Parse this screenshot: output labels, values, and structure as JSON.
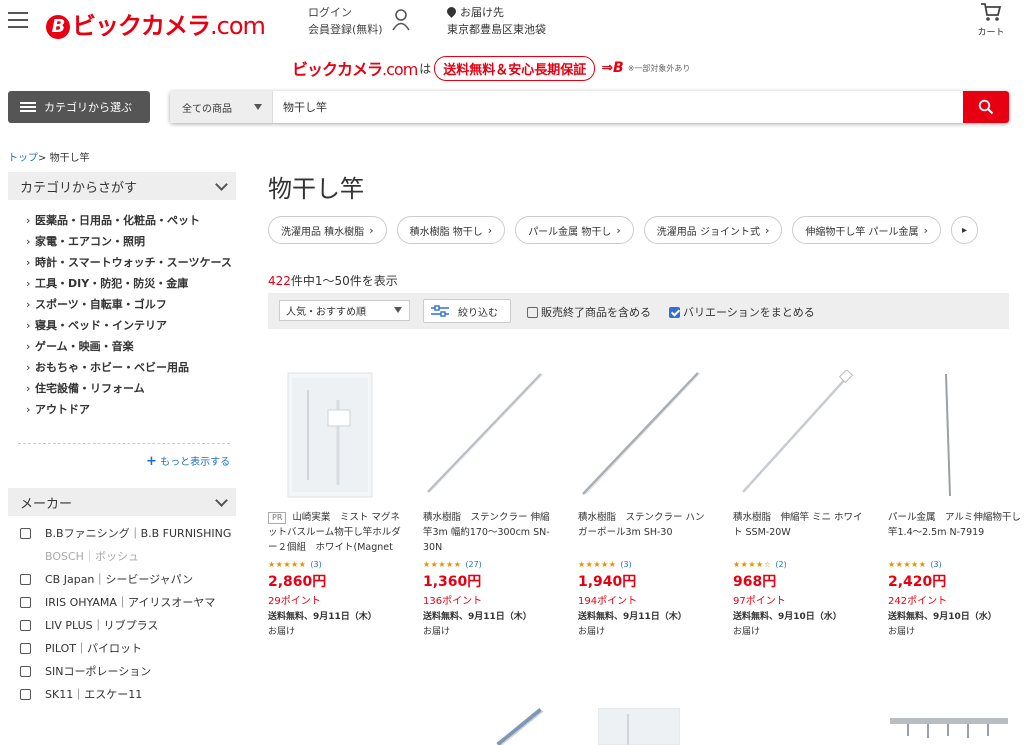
{
  "header": {
    "logo_text": "ビックカメラ",
    "logo_domain": ".com",
    "login_label": "ログイン",
    "register_label": "会員登録(無料)",
    "deliver_label": "お届け先",
    "deliver_address": "東京都豊島区東池袋",
    "cart_label": "カート"
  },
  "promo": {
    "logo_text": "ビックカメラ",
    "logo_domain": ".com",
    "particle": "は",
    "pill_text": "送料無料＆安心長期保証",
    "note": "※一部対象外あり"
  },
  "search": {
    "category_button": "カテゴリから選ぶ",
    "scope": "全ての商品",
    "query": "物干し竿"
  },
  "breadcrumb": {
    "top": "トップ",
    "sep": ">",
    "current": "物干し竿"
  },
  "sidebar": {
    "category_heading": "カテゴリからさがす",
    "categories": [
      "医薬品・日用品・化粧品・ペット",
      "家電・エアコン・照明",
      "時計・スマートウォッチ・スーツケース",
      "工具・DIY・防犯・防災・金庫",
      "スポーツ・自転車・ゴルフ",
      "寝具・ベッド・インテリア",
      "ゲーム・映画・音楽",
      "おもちゃ・ホビー・ベビー用品",
      "住宅設備・リフォーム",
      "アウトドア"
    ],
    "more_label": "もっと表示する",
    "maker_heading": "メーカー",
    "makers": [
      {
        "label": "B.Bファニシング｜B.B FURNISHING",
        "disabled": false
      },
      {
        "label": "BOSCH｜ボッシュ",
        "disabled": true
      },
      {
        "label": "CB Japan｜シービージャパン",
        "disabled": false
      },
      {
        "label": "IRIS OHYAMA｜アイリスオーヤマ",
        "disabled": false
      },
      {
        "label": "LIV PLUS｜リブプラス",
        "disabled": false
      },
      {
        "label": "PILOT｜パイロット",
        "disabled": false
      },
      {
        "label": "SINコーポレーション",
        "disabled": false
      },
      {
        "label": "SK11｜エスケー11",
        "disabled": false
      }
    ]
  },
  "main": {
    "title": "物干し竿",
    "chips": [
      "洗濯用品 積水樹脂",
      "積水樹脂 物干し",
      "パール金属 物干し",
      "洗濯用品 ジョイント式",
      "伸縮物干し竿 パール金属"
    ],
    "count_total": "422",
    "count_text": "件中1〜50件を表示",
    "sort_label": "人気・おすすめ順",
    "filter_label": "絞り込む",
    "include_discontinued": "販売終了商品を含める",
    "group_variations": "バリエーションをまとめる",
    "products": [
      {
        "pr": "PR",
        "name": "山崎実業　ミスト マグネットバスルーム物干し竿ホルダー２個組　ホワイト(Magnet Bathroom Laundry Pipe Holder) ホ…",
        "stars": "★★★★★",
        "reviews": "(3)",
        "price": "2,860円",
        "points": "29ポイント",
        "shipping": "送料無料、9月11日（木）",
        "delivery": "お届け"
      },
      {
        "pr": "",
        "name": "積水樹脂　ステンクラー 伸縮竿3m 幅約170〜300cm SN-30N",
        "stars": "★★★★★",
        "reviews": "(27)",
        "price": "1,360円",
        "points": "136ポイント",
        "shipping": "送料無料、9月11日（木）",
        "delivery": "お届け"
      },
      {
        "pr": "",
        "name": "積水樹脂　ステンクラー ハンガーポール3m SH-30",
        "stars": "★★★★★",
        "reviews": "(3)",
        "price": "1,940円",
        "points": "194ポイント",
        "shipping": "送料無料、9月11日（木）",
        "delivery": "お届け"
      },
      {
        "pr": "",
        "name": "積水樹脂　伸縮竿 ミニ ホワイト SSM-20W",
        "stars": "★★★★☆",
        "reviews": "(2)",
        "price": "968円",
        "points": "97ポイント",
        "shipping": "送料無料、9月10日（水）",
        "delivery": "お届け"
      },
      {
        "pr": "",
        "name": "パール金属　アルミ伸縮物干し竿1.4〜2.5m N-7919",
        "stars": "★★★★★",
        "reviews": "(3)",
        "price": "2,420円",
        "points": "242ポイント",
        "shipping": "送料無料、9月10日（水）",
        "delivery": "お届け"
      }
    ]
  }
}
